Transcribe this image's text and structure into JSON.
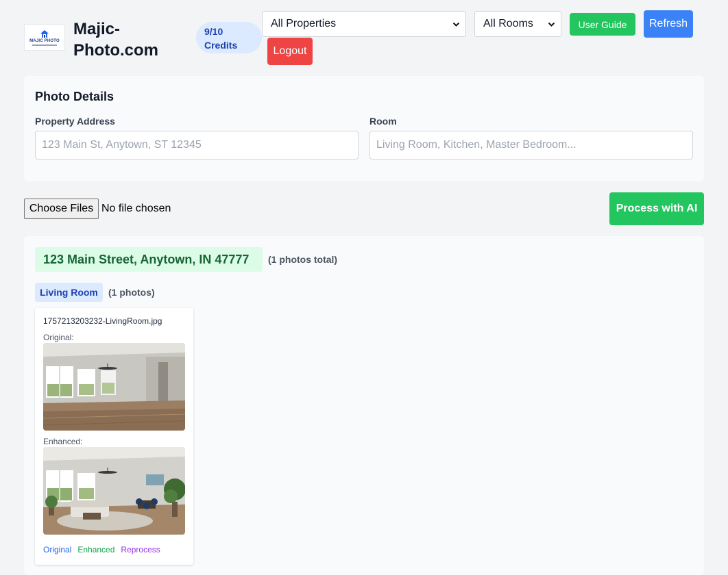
{
  "header": {
    "logo_text": "MAJIC PHOTO",
    "site_title": "Majic-Photo.com",
    "credits_label": "9/10 Credits",
    "property_filter": "All Properties",
    "room_filter": "All Rooms",
    "user_guide_label": "User Guide",
    "refresh_label": "Refresh",
    "logout_label": "Logout"
  },
  "details": {
    "title": "Photo Details",
    "address_label": "Property Address",
    "address_placeholder": "123 Main St, Anytown, ST 12345",
    "room_label": "Room",
    "room_placeholder": "Living Room, Kitchen, Master Bedroom..."
  },
  "upload": {
    "choose_label": "Choose Files",
    "status": "No file chosen",
    "process_label": "Process with AI"
  },
  "results": {
    "address": "123 Main Street, Anytown, IN 47777",
    "address_count": "(1 photos total)",
    "room": "Living Room",
    "room_count": "(1 photos)",
    "photo": {
      "filename": "1757213203232-LivingRoom.jpg",
      "original_caption": "Original:",
      "enhanced_caption": "Enhanced:",
      "link_original": "Original",
      "link_enhanced": "Enhanced",
      "link_reprocess": "Reprocess"
    }
  },
  "colors": {
    "primary_blue": "#3b82f6",
    "success_green": "#22c55e",
    "danger_red": "#ef4444"
  }
}
